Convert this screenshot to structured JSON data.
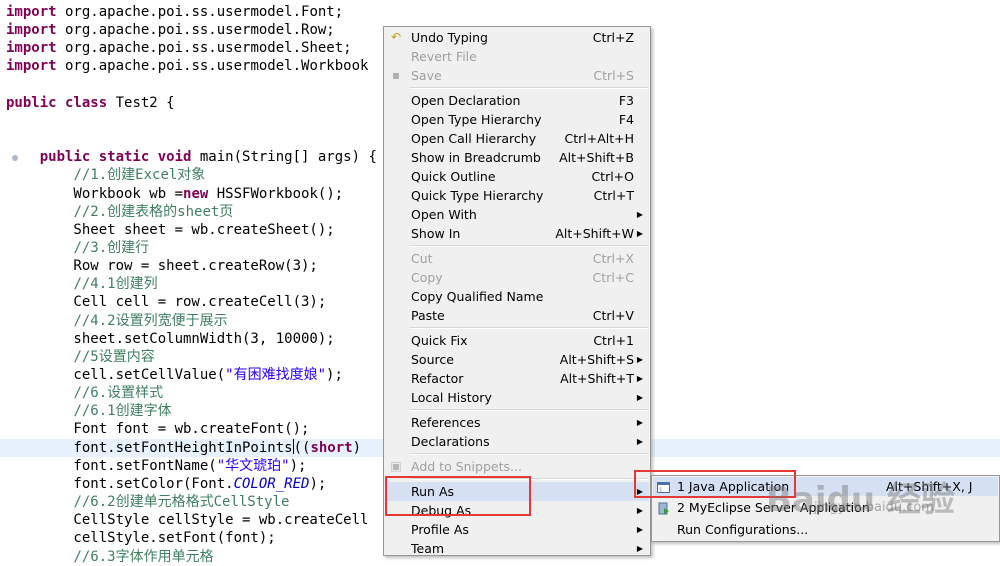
{
  "editor": {
    "lines": [
      [
        {
          "t": "import",
          "c": "kw"
        },
        {
          "t": " org.apache.poi.ss.usermodel.Font;"
        }
      ],
      [
        {
          "t": "import",
          "c": "kw"
        },
        {
          "t": " org.apache.poi.ss.usermodel.Row;"
        }
      ],
      [
        {
          "t": "import",
          "c": "kw"
        },
        {
          "t": " org.apache.poi.ss.usermodel.Sheet;"
        }
      ],
      [
        {
          "t": "import",
          "c": "kw"
        },
        {
          "t": " org.apache.poi.ss.usermodel.Workbook"
        }
      ],
      [],
      [
        {
          "t": "public class",
          "c": "kw"
        },
        {
          "t": " Test2 {"
        }
      ],
      [],
      [],
      [
        {
          "t": "    "
        },
        {
          "t": "public static void",
          "c": "kw"
        },
        {
          "t": " main(String[] args) {"
        }
      ],
      [
        {
          "t": "        "
        },
        {
          "t": "//1.创建Excel对象",
          "c": "cm"
        }
      ],
      [
        {
          "t": "        Workbook wb ="
        },
        {
          "t": "new",
          "c": "kw"
        },
        {
          "t": " HSSFWorkbook();"
        }
      ],
      [
        {
          "t": "        "
        },
        {
          "t": "//2.创建表格的sheet页",
          "c": "cm"
        }
      ],
      [
        {
          "t": "        Sheet sheet = wb.createSheet();"
        }
      ],
      [
        {
          "t": "        "
        },
        {
          "t": "//3.创建行",
          "c": "cm"
        }
      ],
      [
        {
          "t": "        Row row = sheet.createRow(3);"
        }
      ],
      [
        {
          "t": "        "
        },
        {
          "t": "//4.1创建列",
          "c": "cm"
        }
      ],
      [
        {
          "t": "        Cell cell = row.createCell(3);"
        }
      ],
      [
        {
          "t": "        "
        },
        {
          "t": "//4.2设置列宽便于展示",
          "c": "cm"
        }
      ],
      [
        {
          "t": "        sheet.setColumnWidth(3, 10000);"
        }
      ],
      [
        {
          "t": "        "
        },
        {
          "t": "//5设置内容",
          "c": "cm"
        }
      ],
      [
        {
          "t": "        cell.setCellValue("
        },
        {
          "t": "\"有困难找度娘\"",
          "c": "st"
        },
        {
          "t": ");"
        }
      ],
      [
        {
          "t": "        "
        },
        {
          "t": "//6.设置样式",
          "c": "cm"
        }
      ],
      [
        {
          "t": "        "
        },
        {
          "t": "//6.1创建字体",
          "c": "cm"
        }
      ],
      [
        {
          "t": "        Font font = wb.createFont();"
        }
      ],
      [
        {
          "t": "        font.setFontHeightInPoints"
        },
        {
          "cursor": true
        },
        {
          "t": "(("
        },
        {
          "t": "short",
          "c": "kw"
        },
        {
          "t": ")"
        }
      ],
      [
        {
          "t": "        font.setFontName("
        },
        {
          "t": "\"华文琥珀\"",
          "c": "st"
        },
        {
          "t": ");"
        }
      ],
      [
        {
          "t": "        font.setColor(Font."
        },
        {
          "t": "COLOR_RED",
          "c": "fi"
        },
        {
          "t": ");"
        }
      ],
      [
        {
          "t": "        "
        },
        {
          "t": "//6.2创建单元格格式CellStyle",
          "c": "cm"
        }
      ],
      [
        {
          "t": "        CellStyle cellStyle = wb.createCell"
        }
      ],
      [
        {
          "t": "        cellStyle.setFont(font);"
        }
      ],
      [
        {
          "t": "        "
        },
        {
          "t": "//6.3字体作用单元格",
          "c": "cm"
        }
      ]
    ]
  },
  "menu": {
    "items": [
      {
        "type": "item",
        "label": "Undo Typing",
        "shortcut": "Ctrl+Z",
        "icon": "undo-icon",
        "disabled": false,
        "submenu": false
      },
      {
        "type": "item",
        "label": "Revert File",
        "shortcut": "",
        "disabled": true,
        "submenu": false
      },
      {
        "type": "item",
        "label": "Save",
        "shortcut": "Ctrl+S",
        "icon": "save-icon",
        "disabled": true,
        "submenu": false
      },
      {
        "type": "sep"
      },
      {
        "type": "item",
        "label": "Open Declaration",
        "shortcut": "F3",
        "disabled": false,
        "submenu": false
      },
      {
        "type": "item",
        "label": "Open Type Hierarchy",
        "shortcut": "F4",
        "disabled": false,
        "submenu": false
      },
      {
        "type": "item",
        "label": "Open Call Hierarchy",
        "shortcut": "Ctrl+Alt+H",
        "disabled": false,
        "submenu": false
      },
      {
        "type": "item",
        "label": "Show in Breadcrumb",
        "shortcut": "Alt+Shift+B",
        "disabled": false,
        "submenu": false
      },
      {
        "type": "item",
        "label": "Quick Outline",
        "shortcut": "Ctrl+O",
        "disabled": false,
        "submenu": false
      },
      {
        "type": "item",
        "label": "Quick Type Hierarchy",
        "shortcut": "Ctrl+T",
        "disabled": false,
        "submenu": false
      },
      {
        "type": "item",
        "label": "Open With",
        "shortcut": "",
        "disabled": false,
        "submenu": true
      },
      {
        "type": "item",
        "label": "Show In",
        "shortcut": "Alt+Shift+W",
        "disabled": false,
        "submenu": true
      },
      {
        "type": "sep"
      },
      {
        "type": "item",
        "label": "Cut",
        "shortcut": "Ctrl+X",
        "disabled": true,
        "submenu": false
      },
      {
        "type": "item",
        "label": "Copy",
        "shortcut": "Ctrl+C",
        "disabled": true,
        "submenu": false
      },
      {
        "type": "item",
        "label": "Copy Qualified Name",
        "shortcut": "",
        "disabled": false,
        "submenu": false
      },
      {
        "type": "item",
        "label": "Paste",
        "shortcut": "Ctrl+V",
        "disabled": false,
        "submenu": false
      },
      {
        "type": "sep"
      },
      {
        "type": "item",
        "label": "Quick Fix",
        "shortcut": "Ctrl+1",
        "disabled": false,
        "submenu": false
      },
      {
        "type": "item",
        "label": "Source",
        "shortcut": "Alt+Shift+S",
        "disabled": false,
        "submenu": true
      },
      {
        "type": "item",
        "label": "Refactor",
        "shortcut": "Alt+Shift+T",
        "disabled": false,
        "submenu": true
      },
      {
        "type": "item",
        "label": "Local History",
        "shortcut": "",
        "disabled": false,
        "submenu": true
      },
      {
        "type": "sep"
      },
      {
        "type": "item",
        "label": "References",
        "shortcut": "",
        "disabled": false,
        "submenu": true
      },
      {
        "type": "item",
        "label": "Declarations",
        "shortcut": "",
        "disabled": false,
        "submenu": true
      },
      {
        "type": "sep"
      },
      {
        "type": "item",
        "label": "Add to Snippets...",
        "shortcut": "",
        "icon": "snippet-icon",
        "disabled": true,
        "submenu": false
      },
      {
        "type": "sep"
      },
      {
        "type": "item",
        "label": "Run As",
        "shortcut": "",
        "disabled": false,
        "submenu": true,
        "active": true
      },
      {
        "type": "item",
        "label": "Debug As",
        "shortcut": "",
        "disabled": false,
        "submenu": true
      },
      {
        "type": "item",
        "label": "Profile As",
        "shortcut": "",
        "disabled": false,
        "submenu": true
      },
      {
        "type": "item",
        "label": "Team",
        "shortcut": "",
        "disabled": false,
        "submenu": true
      }
    ]
  },
  "submenu": {
    "items": [
      {
        "label": "1 Java Application",
        "shortcut": "Alt+Shift+X, J",
        "icon": "java-app-icon",
        "active": true
      },
      {
        "label": "2 MyEclipse Server Application",
        "shortcut": "",
        "icon": "server-app-icon",
        "active": false
      },
      {
        "label": "Run Configurations...",
        "shortcut": "",
        "icon": "",
        "active": false
      }
    ]
  },
  "watermark": {
    "logo": "Baidu 经验",
    "url": "jingyan.baidu.com"
  }
}
